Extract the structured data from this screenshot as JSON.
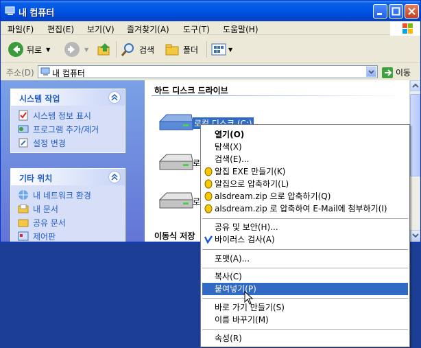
{
  "window": {
    "title": "내 컴퓨터"
  },
  "menubar": {
    "items": [
      "파일(F)",
      "편집(E)",
      "보기(V)",
      "즐겨찾기(A)",
      "도구(T)",
      "도움말(H)"
    ]
  },
  "toolbar": {
    "back_label": "뒤로",
    "search_label": "검색",
    "folders_label": "폴더"
  },
  "address": {
    "label": "주소(D)",
    "value": "내 컴퓨터",
    "go_label": "이동"
  },
  "leftpane": {
    "system_tasks": {
      "title": "시스템 작업",
      "items": [
        "시스템 정보 표시",
        "프로그램 추가/제거",
        "설정 변경"
      ]
    },
    "other_places": {
      "title": "기타 위치",
      "items": [
        "내 네트워크 환경",
        "내 문서",
        "공유 문서",
        "제어판"
      ]
    }
  },
  "main": {
    "hdd_section": "하드 디스크 드라이브",
    "drives": [
      "로컬 디스크 (C:)",
      "로",
      "로"
    ],
    "removable_section": "이동식 저장"
  },
  "context_menu": {
    "items": [
      "열기(O)",
      "탐색(X)",
      "검색(E)...",
      "알집 EXE 만들기(K)",
      "알집으로 압축하기(L)",
      "alsdream.zip 으로 압축하기(Q)",
      "alsdream.zip 로 압축하여 E-Mail에 첨부하기(I)",
      "공유 및 보안(H)...",
      "바이러스 검사(A)",
      "포맷(A)...",
      "복사(C)",
      "붙여넣기(P)",
      "바로 가기 만들기(S)",
      "이름 바꾸기(M)",
      "속성(R)"
    ]
  },
  "colors": {
    "titlebar": "#0055e5",
    "highlight": "#316ac5",
    "desktop": "#1c3f95",
    "taskpane_link": "#215dc6"
  }
}
